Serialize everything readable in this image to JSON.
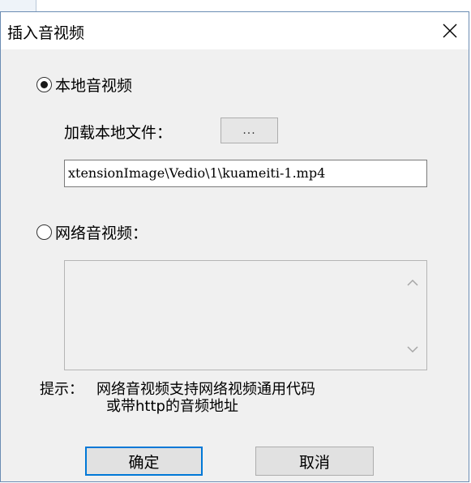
{
  "dialog": {
    "title": "插入音视频",
    "close_icon": "close-icon"
  },
  "local": {
    "radio_label": "本地音视频",
    "selected": true,
    "load_label": "加载本地文件：",
    "browse_label": "...",
    "file_path": "xtensionImage\\Vedio\\1\\kuameiti-1.mp4"
  },
  "network": {
    "radio_label": "网络音视频：",
    "selected": false,
    "url_value": ""
  },
  "hint": {
    "prefix": "提示：",
    "line1": "网络音视频支持网络视频通用代码",
    "line2": "或带http的音频地址"
  },
  "buttons": {
    "ok_label": "确定",
    "cancel_label": "取消"
  }
}
